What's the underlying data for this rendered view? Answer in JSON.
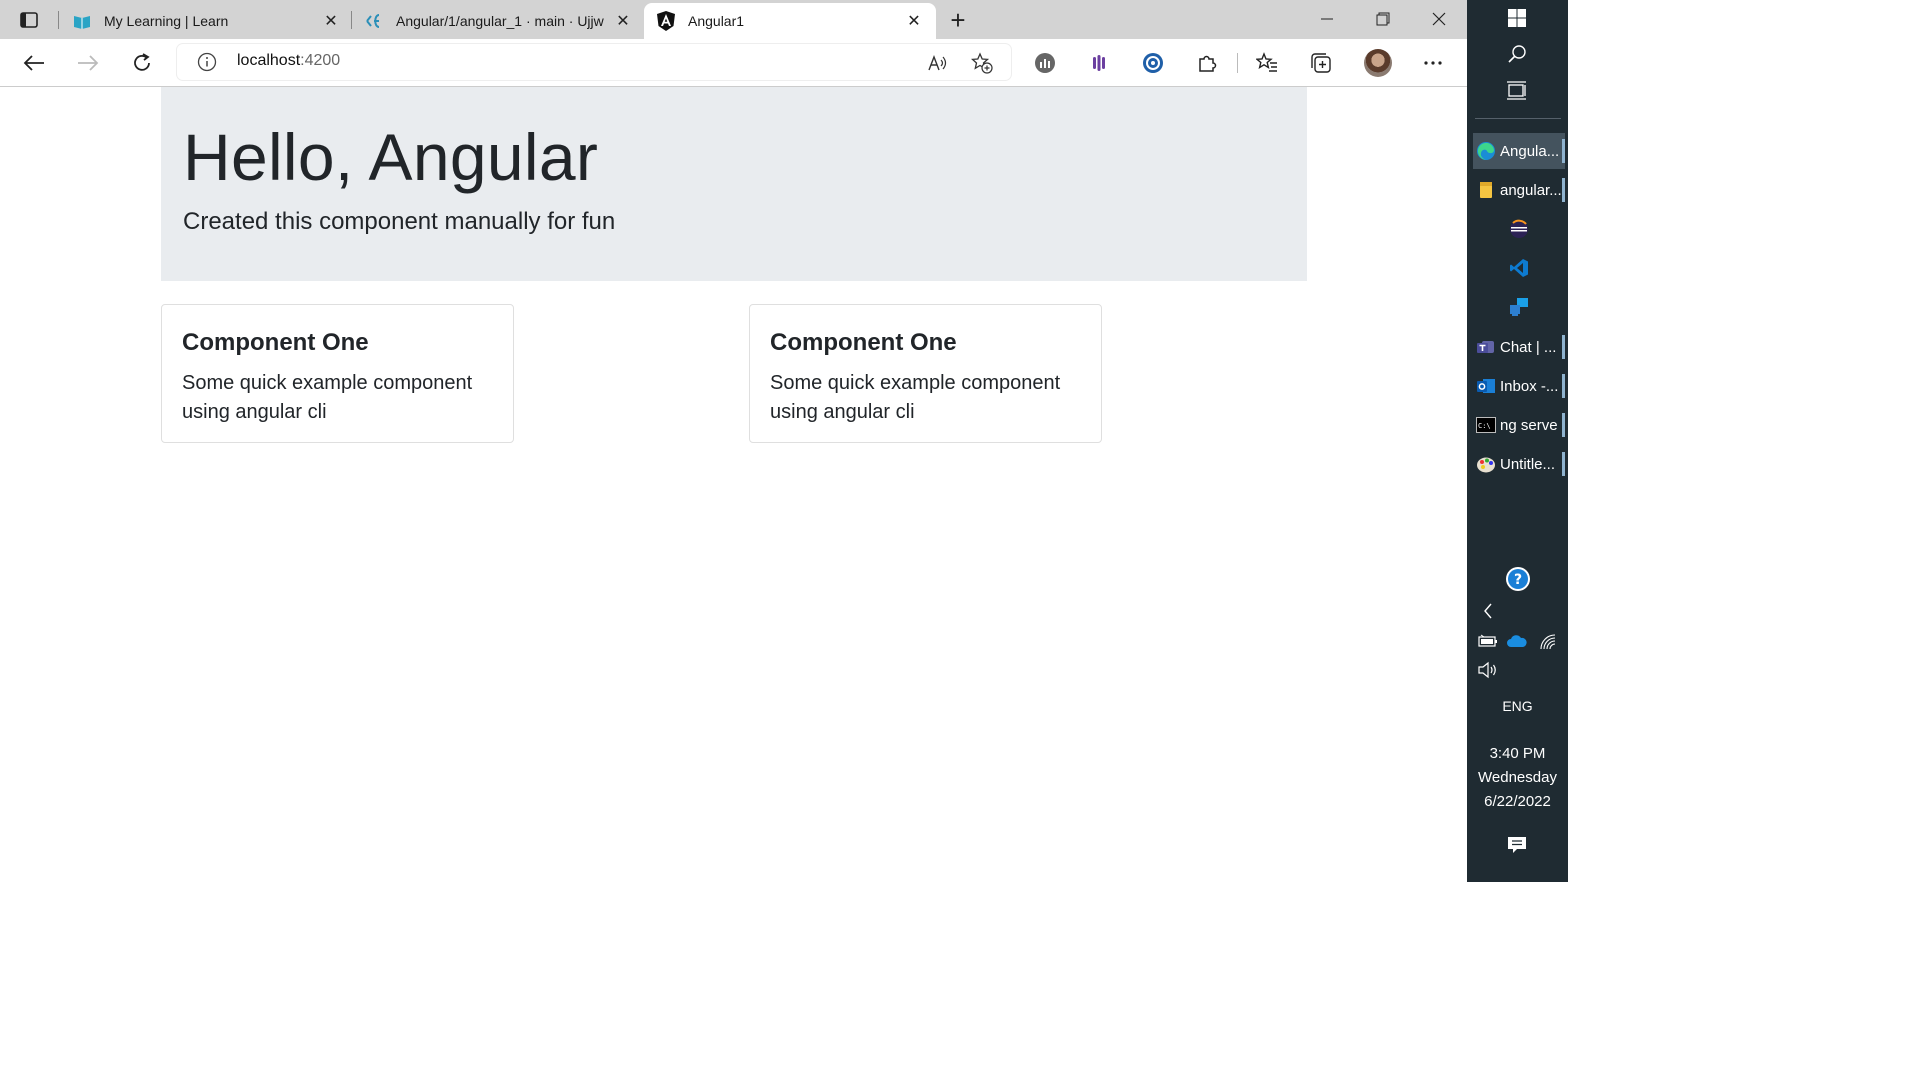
{
  "browser": {
    "tabs": [
      {
        "title": "My Learning | Learn",
        "favicon": "learn-book-icon"
      },
      {
        "title": "Angular/1/angular_1 · main · Ujjw",
        "favicon": "azure-devops-icon"
      },
      {
        "title": "Angular1",
        "favicon": "angular-icon"
      }
    ],
    "address": {
      "host": "localhost",
      "port": ":4200"
    }
  },
  "page": {
    "jumbotron": {
      "heading": "Hello, Angular",
      "lead": "Created this component manually for fun"
    },
    "cards": [
      {
        "title": "Component One",
        "text": "Some quick example component using angular cli"
      },
      {
        "title": "Component One",
        "text": "Some quick example component using angular cli"
      }
    ]
  },
  "taskbar": {
    "apps": [
      {
        "label": "Angula...",
        "icon": "edge-icon",
        "active": true
      },
      {
        "label": "angular...",
        "icon": "folder-icon"
      },
      {
        "label": "",
        "icon": "eclipse-icon"
      },
      {
        "label": "",
        "icon": "vscode-icon"
      },
      {
        "label": "",
        "icon": "remote-desktop-icon"
      },
      {
        "label": "Chat | ...",
        "icon": "teams-icon"
      },
      {
        "label": "Inbox -...",
        "icon": "outlook-icon"
      },
      {
        "label": "ng serve",
        "icon": "cmd-icon"
      },
      {
        "label": "Untitle...",
        "icon": "paint-icon"
      }
    ],
    "language": "ENG",
    "time": "3:40 PM",
    "day": "Wednesday",
    "date": "6/22/2022"
  }
}
